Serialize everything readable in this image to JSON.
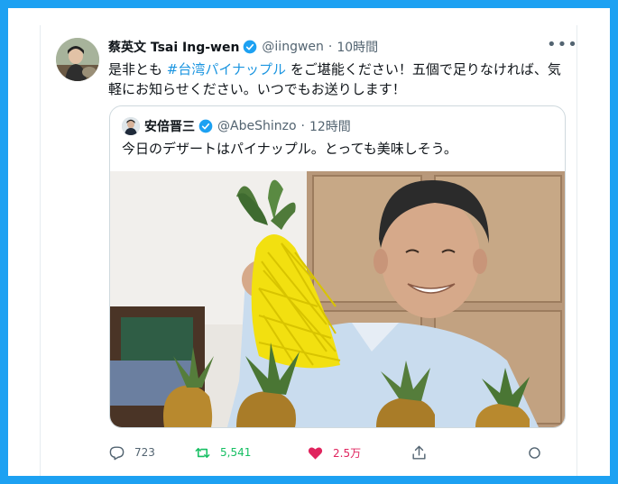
{
  "tweet": {
    "author_name": "蔡英文 Tsai Ing-wen",
    "handle": "@iingwen",
    "time": "10時間",
    "text_before": "是非とも ",
    "hashtag": "#台湾パイナップル",
    "text_after": " をご堪能ください！五個で足りなければ、気軽にお知らせください。いつでもお送りします！",
    "more_icon": "more-horizontal-icon"
  },
  "quoted": {
    "author_name": "安倍晋三",
    "handle": "@AbeShinzo",
    "time": "12時間",
    "text": "今日のデザートはパイナップル。とっても美味しそう。"
  },
  "actions": {
    "reply_count": "723",
    "retweet_count": "5,541",
    "like_count": "2.5万"
  },
  "colors": {
    "accent": "#1da1f2",
    "hashtag": "#1b95e0",
    "retweet": "#17bf63",
    "like": "#e0245e",
    "muted": "#536471"
  }
}
